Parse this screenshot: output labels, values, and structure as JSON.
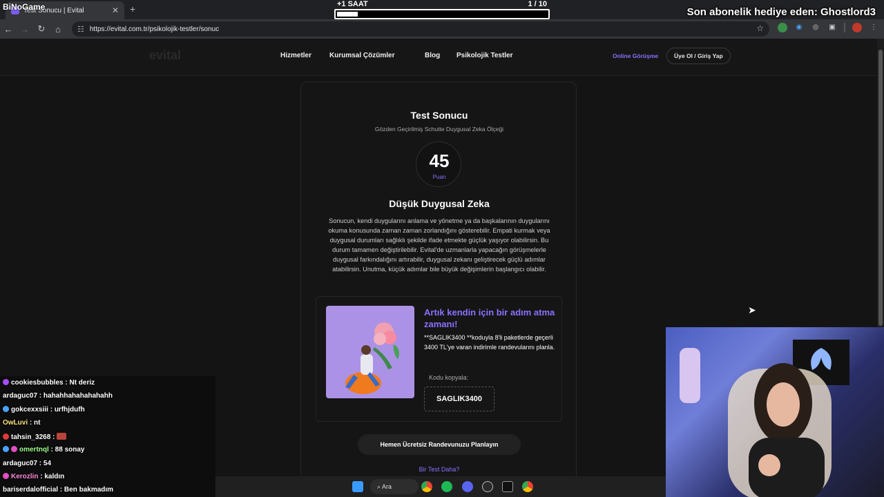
{
  "browser": {
    "tab_title": "Test Sonucu | Evital",
    "url": "https://evital.com.tr/psikolojik-testler/sonuc"
  },
  "stream": {
    "logo_text": "BiNoGame",
    "goal_left": "+1 SAAT",
    "goal_right": "1 / 10",
    "goal_progress": 0.1,
    "sub_gift": "Son abonelik hediye eden: Ghostlord3"
  },
  "site": {
    "logo": "evital",
    "menu": [
      "Hizmetler",
      "Kurumsal Çözümler",
      "Blog",
      "Psikolojik Testler"
    ],
    "online_btn": "Online Görüşme",
    "login_btn": "Üye Ol / Giriş Yap"
  },
  "result": {
    "title": "Test Sonucu",
    "subtitle": "Gözden Geçirilmiş Schutte Duygusal Zeka Ölçeği",
    "score": "45",
    "score_label": "Puan",
    "level": "Düşük Duygusal Zeka",
    "description": "Sonucun, kendi duygularını anlama ve yönetme ya da başkalarının duygularını okuma konusunda zaman zaman zorlandığını gösterebilir. Empati kurmak veya duygusal durumları sağlıklı şekilde ifade etmekte güçlük yaşıyor olabilirsin. Bu durum tamamen değiştirilebilir. Evital'de uzmanlarla yapacağın görüşmelerle duygusal farkındalığını artırabilir, duygusal zekanı geliştirecek güçlü adımlar atabilirsin. Unutma, küçük adımlar bile büyük değişimlerin başlangıcı olabilir."
  },
  "promo": {
    "title": "Artık kendin için bir adım atma zamanı!",
    "text": "**SAGLIK3400 **koduyla 8'li paketlerde geçerli 3400 TL'ye varan indirimle randevularını planla.",
    "copy_label": "Kodu kopyala:",
    "code": "SAGLIK3400"
  },
  "cta": "Hemen Ücretsiz Randevunuzu Planlayın",
  "another_test": "Bir Test Daha?",
  "chat": [
    {
      "user": "cookiesbubbles",
      "msg": "Nt deriz",
      "color": "#ffffff"
    },
    {
      "user": "ardaguc07",
      "msg": "hahahhahahahahahh",
      "color": "#ffffff"
    },
    {
      "user": "gokcexxsiii",
      "msg": "urfhjdufh",
      "color": "#ffffff"
    },
    {
      "user": "OwLuvi",
      "msg": "nt",
      "color": "#ffe27a"
    },
    {
      "user": "tahsin_3268",
      "msg": "",
      "color": "#ffffff"
    },
    {
      "user": "omertnql",
      "msg": "88 sonay",
      "color": "#9dff8a"
    },
    {
      "user": "ardaguc07",
      "msg": "54",
      "color": "#ffffff"
    },
    {
      "user": "Kerozlin",
      "msg": "kaldın",
      "color": "#ff8ad8"
    },
    {
      "user": "bariserdalofficial",
      "msg": "Ben bakmadım",
      "color": "#ffffff"
    }
  ],
  "taskbar": {
    "search_label": "Ara"
  }
}
